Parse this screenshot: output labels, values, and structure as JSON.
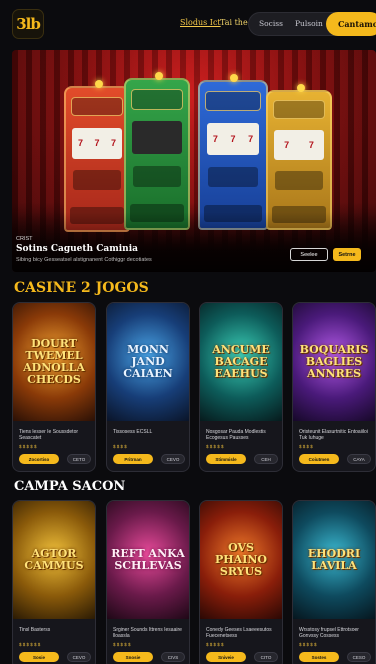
{
  "header": {
    "logo_text": "3lb",
    "nav": [
      {
        "label": "Slodus Ict",
        "active": true
      },
      {
        "label": "Tai the",
        "active": false
      }
    ],
    "pill_items": [
      "Sociss",
      "Pulsoin"
    ],
    "cta_label": "Cantamol"
  },
  "hero": {
    "eyebrow": "CRIST",
    "title": "Sotins Cagueth Caminia",
    "description": "Sibing bicy Gesseatsel alstignanent Cothiggr decotiates",
    "btn_outline_label": "Seelee",
    "btn_label": "Setrne",
    "reel_symbols": [
      "7",
      "7",
      "7"
    ]
  },
  "sections": [
    {
      "title": "CASINE 2 JOGOS",
      "cards": [
        {
          "art": "DOURT TWEMEL ADNOLLA CHECDS",
          "name": "Tiens lesser Ie Soussdetor Seascatet",
          "meta": "$ $ $  $ $",
          "btn": "Zocortiso",
          "btn2": "CETO",
          "theme": "orange"
        },
        {
          "art": "MONN JAND CAIAEN",
          "name": "Tissosess ECSLL",
          "meta": "$ $  $ $",
          "btn": "Pritrnan",
          "btn2": "CEVO",
          "theme": "blue"
        },
        {
          "art": "ANCUME BACAGE EAEHUS",
          "name": "Nosgosar Pauda Modlestis Ecogesus Pausses",
          "meta": "$ $  $ $ $",
          "btn": "Stimmisle",
          "btn2": "CEH",
          "theme": "teal"
        },
        {
          "art": "BOQUARIS BAGLIES ANNRES",
          "name": "Oristeunit Elasurtnitic Entoaiiloi Tuk Iuhuge",
          "meta": "$ $  $ $",
          "btn": "Coiutmen",
          "btn2": "CAYA",
          "theme": "purple"
        }
      ]
    },
    {
      "title": "CAMPA SACON",
      "cards": [
        {
          "art": "AGTOR CAMMUS",
          "name": "Tinsl Basterss",
          "meta": "$ $ $  $ $ $",
          "btn": "Sosie",
          "btn2": "CEVO",
          "theme": "gold"
        },
        {
          "art": "REFT ANKA SCHLEVAS",
          "name": "Srginer Sounds Ittrens Iesaaire lloassla",
          "meta": "$ $  $ $ $",
          "btn": "Snosie",
          "btn2": "CIVS",
          "theme": "pink"
        },
        {
          "art": "OVS PHAINO SRYUS",
          "name": "Conedy Geeses Lsaeeesutos Fuecenetsess",
          "meta": "$ $ $  $ $",
          "btn": "Sniveie",
          "btn2": "CITO",
          "theme": "red"
        },
        {
          "art": "EHODRI LAVILA",
          "name": "Wrsstosy frupsel Ettrotsoer Gonvssy Cossess",
          "meta": "$ $  $ $ $",
          "btn": "Sostes",
          "btn2": "CESO",
          "theme": "cyan"
        }
      ]
    }
  ],
  "colors": {
    "accent": "#f5b91c",
    "background": "#0b0b0e",
    "card": "#16161c"
  }
}
